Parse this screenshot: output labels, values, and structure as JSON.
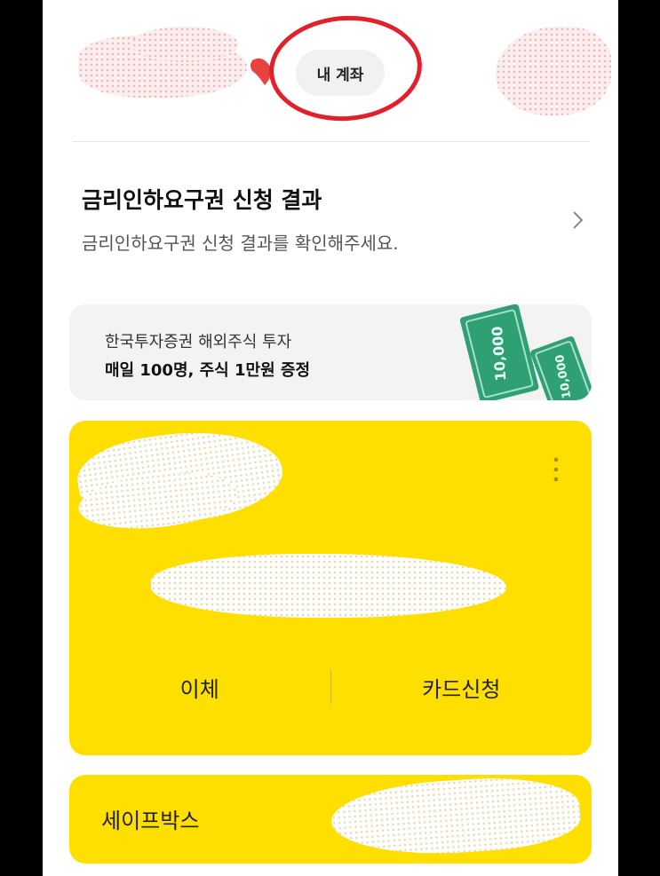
{
  "header": {
    "my_account_label": "내 계좌"
  },
  "rate_cut": {
    "title": "금리인하요구권 신청 결과",
    "subtitle": "금리인하요구권 신청 결과를 확인해주세요.",
    "chevron_icon": "chevron-right-icon"
  },
  "ad_banner": {
    "line1": "한국투자증권 해외주식 투자",
    "line2": "매일 100명, 주식 1만원 증정",
    "bill_text_1": "10,000",
    "bill_text_2": "10,000"
  },
  "account_card": {
    "more_icon": "vertical-dots-icon",
    "transfer_label": "이체",
    "card_apply_label": "카드신청",
    "background_color": "#ffdf00"
  },
  "safebox": {
    "label": "세이프박스"
  },
  "colors": {
    "accent_yellow": "#ffdf00",
    "annotation_red": "#e21f2b",
    "money_green": "#2f9f74"
  }
}
